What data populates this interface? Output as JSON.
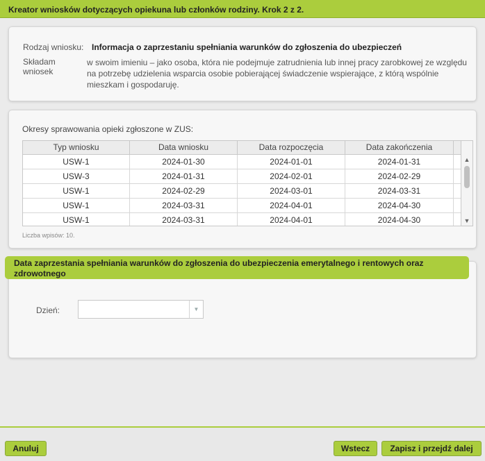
{
  "header": {
    "title": "Kreator wniosków dotyczących opiekuna lub członków rodziny. Krok 2 z 2."
  },
  "request": {
    "type_label": "Rodzaj wniosku:",
    "type_value": "Informacja o zaprzestaniu spełniania warunków do zgłoszenia do ubezpieczeń",
    "submit_label": "Składam wniosek",
    "declaration": "w swoim imieniu – jako osoba, która nie podejmuje zatrudnienia lub innej pracy zarobkowej ze względu na potrzebę udzielenia wsparcia osobie pobierającej świadczenie wspierające, z którą wspólnie mieszkam i gospodaruję."
  },
  "periods": {
    "caption": "Okresy sprawowania opieki zgłoszone w ZUS:",
    "columns": [
      "Typ wniosku",
      "Data wniosku",
      "Data rozpoczęcia",
      "Data zakończenia"
    ],
    "rows": [
      [
        "USW-1",
        "2024-01-30",
        "2024-01-01",
        "2024-01-31"
      ],
      [
        "USW-3",
        "2024-01-31",
        "2024-02-01",
        "2024-02-29"
      ],
      [
        "USW-1",
        "2024-02-29",
        "2024-03-01",
        "2024-03-31"
      ],
      [
        "USW-1",
        "2024-03-31",
        "2024-04-01",
        "2024-04-30"
      ],
      [
        "USW-1",
        "2024-03-31",
        "2024-04-01",
        "2024-04-30"
      ]
    ],
    "count_text": "Liczba wpisów: 10."
  },
  "cessation": {
    "title": "Data zaprzestania spełniania warunków do zgłoszenia do ubezpieczenia emerytalnego i rentowych oraz zdrowotnego",
    "day_label": "Dzień:",
    "day_value": ""
  },
  "footer": {
    "cancel": "Anuluj",
    "back": "Wstecz",
    "next": "Zapisz i przejdź dalej"
  },
  "colors": {
    "accent": "#abcd3d",
    "accent_border": "#8aa83a"
  },
  "icons": {
    "scroll_up": "chevron-up-icon",
    "scroll_down": "chevron-down-icon",
    "select_arrow": "chevron-down-icon"
  }
}
